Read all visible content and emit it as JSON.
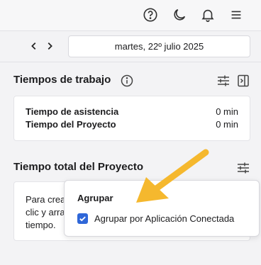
{
  "header": {
    "icons": [
      "help-circle-icon",
      "moon-icon",
      "bell-icon",
      "menu-icon"
    ]
  },
  "date_nav": {
    "date": "martes, 22º julio 2025"
  },
  "work_times": {
    "title": "Tiempos de trabajo",
    "rows": [
      {
        "label": "Tiempo de asistencia",
        "value": "0 min"
      },
      {
        "label": "Tiempo del Proyecto",
        "value": "0 min"
      }
    ]
  },
  "project_total": {
    "title": "Tiempo total del Proyecto",
    "hint_lines": [
      "Para crea",
      "clic y arra",
      "tiempo."
    ]
  },
  "popover": {
    "title": "Agrupar",
    "option_label": "Agrupar por Aplicación Conectada",
    "option_checked": true
  },
  "colors": {
    "accent": "#2f67d8",
    "annotation_arrow": "#f5b82e"
  }
}
